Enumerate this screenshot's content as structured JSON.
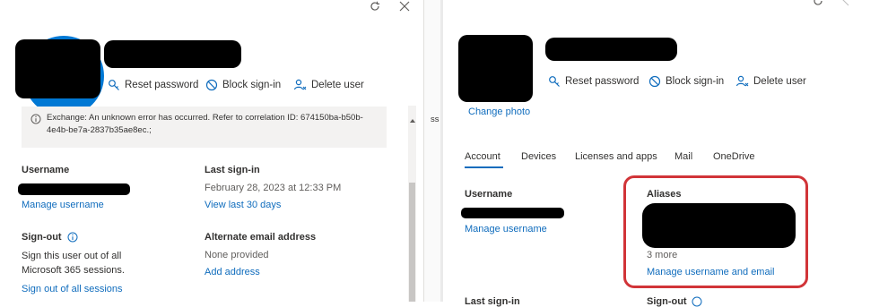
{
  "left_panel": {
    "window_controls": {
      "refresh_icon": "refresh-icon",
      "close_icon": "close-icon"
    },
    "actions": {
      "reset_password": "Reset password",
      "block_signin": "Block sign-in",
      "delete_user": "Delete user"
    },
    "error_banner": {
      "icon": "info-icon",
      "line1": "Exchange: An unknown error has occurred. Refer to correlation ID: 674150ba-b50b-",
      "line2": "4e4b-be7a-2837b35ae8ec.;"
    },
    "username": {
      "label": "Username",
      "link": "Manage username"
    },
    "last_signin": {
      "label": "Last sign-in",
      "value": "February 28, 2023 at 12:33 PM",
      "link": "View last 30 days"
    },
    "signout": {
      "label": "Sign-out",
      "line1": "Sign this user out of all",
      "line2": "Microsoft 365 sessions.",
      "link": "Sign out of all sessions"
    },
    "alternate_email": {
      "label": "Alternate email address",
      "value": "None provided",
      "link": "Add address"
    }
  },
  "middle_fragment": {
    "text": "ss"
  },
  "right_panel": {
    "actions": {
      "reset_password": "Reset password",
      "block_signin": "Block sign-in",
      "delete_user": "Delete user"
    },
    "change_photo": "Change photo",
    "tabs": [
      {
        "label": "Account"
      },
      {
        "label": "Devices"
      },
      {
        "label": "Licenses and apps"
      },
      {
        "label": "Mail"
      },
      {
        "label": "OneDrive"
      }
    ],
    "username": {
      "label": "Username",
      "link": "Manage username"
    },
    "aliases": {
      "label": "Aliases",
      "more": "3 more",
      "link": "Manage username and email"
    },
    "bottom_cut_labels": {
      "left": "Last sign-in",
      "right": "Sign-out"
    }
  },
  "colors": {
    "link": "#0f6cbd",
    "highlight_border": "#d13438",
    "avatar_blue": "#0078d4",
    "banner_bg": "#f3f2f1"
  }
}
